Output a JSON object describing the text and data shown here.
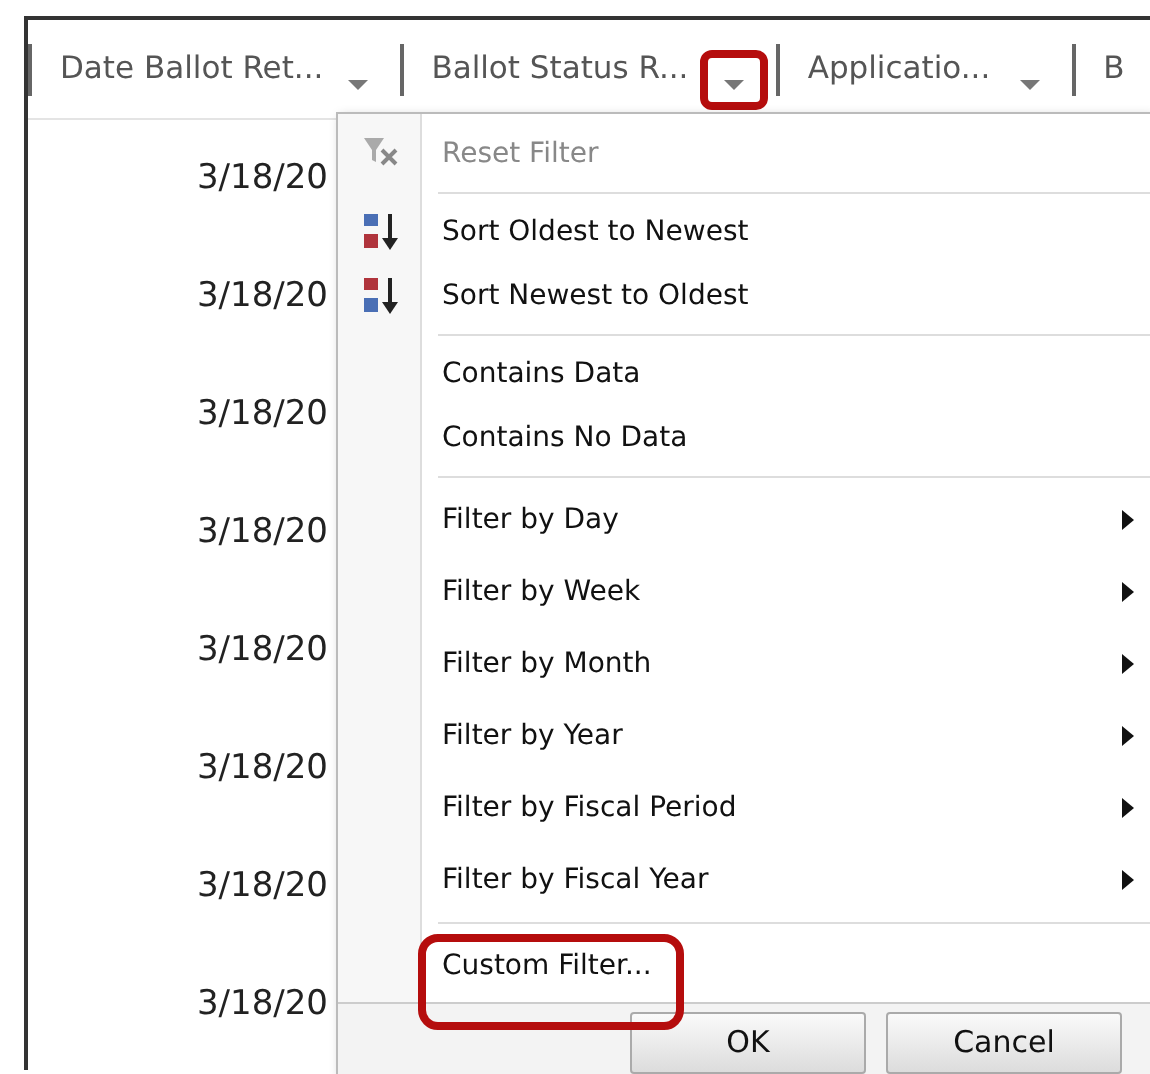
{
  "columns": [
    {
      "label": "Date Ballot Ret...",
      "has_filter": true,
      "highlighted": false
    },
    {
      "label": "Ballot Status R...",
      "has_filter": true,
      "highlighted": true
    },
    {
      "label": "Applicatio...",
      "has_filter": true,
      "highlighted": false
    },
    {
      "label": "B",
      "has_filter": false
    }
  ],
  "rows": [
    {
      "date": "3/18/20"
    },
    {
      "date": "3/18/20"
    },
    {
      "date": "3/18/20"
    },
    {
      "date": "3/18/20"
    },
    {
      "date": "3/18/20"
    },
    {
      "date": "3/18/20"
    },
    {
      "date": "3/18/20"
    },
    {
      "date": "3/18/20"
    }
  ],
  "filter_menu": {
    "items": [
      {
        "kind": "reset_item",
        "label": "Reset Filter",
        "disabled": true,
        "has_submenu": false,
        "highlighted": false
      },
      {
        "kind": "separator"
      },
      {
        "kind": "sort_asc_item",
        "label": "Sort Oldest to Newest",
        "disabled": false,
        "has_submenu": false,
        "highlighted": false
      },
      {
        "kind": "sort_desc_item",
        "label": "Sort Newest to Oldest",
        "disabled": false,
        "has_submenu": false,
        "highlighted": false
      },
      {
        "kind": "separator"
      },
      {
        "kind": "item",
        "label": "Contains Data",
        "disabled": false,
        "has_submenu": false,
        "highlighted": false
      },
      {
        "kind": "item",
        "label": "Contains No Data",
        "disabled": false,
        "has_submenu": false,
        "highlighted": false
      },
      {
        "kind": "separator"
      },
      {
        "kind": "group_item",
        "label": "Filter by Day",
        "disabled": false,
        "has_submenu": true,
        "highlighted": false
      },
      {
        "kind": "group_item",
        "label": "Filter by Week",
        "disabled": false,
        "has_submenu": true,
        "highlighted": false
      },
      {
        "kind": "group_item",
        "label": "Filter by Month",
        "disabled": false,
        "has_submenu": true,
        "highlighted": false
      },
      {
        "kind": "group_item",
        "label": "Filter by Year",
        "disabled": false,
        "has_submenu": true,
        "highlighted": false
      },
      {
        "kind": "group_item",
        "label": "Filter by Fiscal Period",
        "disabled": false,
        "has_submenu": true,
        "highlighted": false
      },
      {
        "kind": "group_item",
        "label": "Filter by Fiscal Year",
        "disabled": false,
        "has_submenu": true,
        "highlighted": false
      },
      {
        "kind": "separator"
      },
      {
        "kind": "group_item",
        "label": "Custom Filter...",
        "disabled": false,
        "has_submenu": false,
        "highlighted": true
      }
    ],
    "buttons": [
      {
        "label": "OK"
      },
      {
        "label": "Cancel"
      }
    ]
  }
}
